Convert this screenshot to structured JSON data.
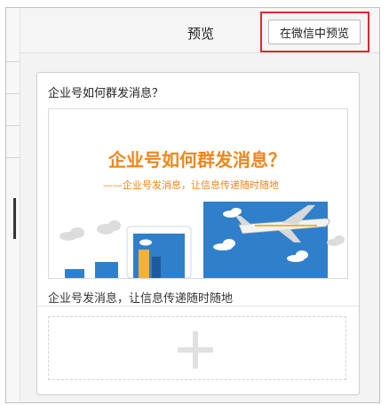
{
  "header": {
    "title": "预览",
    "wechat_preview_label": "在微信中预览"
  },
  "article": {
    "title": "企业号如何群发消息？",
    "cover_headline": "企业号如何群发消息？",
    "cover_subtitle": "——企业号发消息，让信息传递随时随地",
    "description": "企业号发消息，让信息传递随时随地"
  },
  "colors": {
    "highlight_frame": "#e0262f",
    "headline_orange": "#f08519",
    "sky_blue": "#2f7fcb"
  },
  "icons": {
    "add": "plus-icon"
  }
}
